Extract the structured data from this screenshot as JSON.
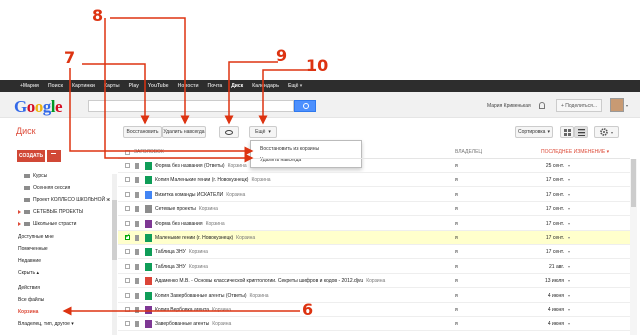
{
  "topbar": {
    "items": [
      "+Мария",
      "Поиск",
      "Картинки",
      "Карты",
      "Play",
      "YouTube",
      "Новости",
      "Почта",
      "Диск",
      "Календарь",
      "Ещё ▾"
    ],
    "active": "Диск"
  },
  "header": {
    "logo_letters": [
      "G",
      "o",
      "o",
      "g",
      "l",
      "e"
    ],
    "user_name": "Мария Кривенькая",
    "share_label": "+ Поделиться...",
    "avatar_caret": "▾"
  },
  "toolbar": {
    "app_title": "Диск",
    "restore_label": "Восстановить",
    "delete_label": "Удалить навсегда",
    "more_label": "Ещё",
    "more_caret": "▾",
    "sort_label": "Сортировка",
    "sort_caret": "▾",
    "gear_caret": "▾"
  },
  "dropdown": {
    "items": [
      "Восстановить из корзины",
      "Удалить навсегда"
    ]
  },
  "sidebar": {
    "create_label": "СОЗДАТЬ",
    "items": [
      {
        "label": "Курсы",
        "type": "folder"
      },
      {
        "label": "Осенняя сессия",
        "type": "folder"
      },
      {
        "label": "Проект КОЛЛЕСО ШКОЛЬНОЙ ж",
        "type": "folder"
      },
      {
        "label": "СЕТЕВЫЕ ПРОЕКТЫ",
        "type": "tree"
      },
      {
        "label": "Школьные страсти",
        "type": "tree"
      },
      {
        "label": "Доступные мне",
        "type": "nav"
      },
      {
        "label": "Помеченные",
        "type": "nav"
      },
      {
        "label": "Недавние",
        "type": "nav"
      },
      {
        "label": "Скрыть ▴",
        "type": "nav"
      },
      {
        "label": "Действия",
        "type": "nav"
      },
      {
        "label": "Все файлы",
        "type": "nav"
      },
      {
        "label": "Корзина",
        "type": "trash"
      },
      {
        "label": "Владелец, тип, другое ▾",
        "type": "nav"
      }
    ]
  },
  "list": {
    "col_title": "ЗАГОЛОВОК",
    "col_owner": "ВЛАДЕЛЕЦ",
    "col_modified": "ПОСЛЕДНЕЕ ИЗМЕНЕНИЕ",
    "col_modified_caret": "▾",
    "trash_tag": "Корзина",
    "row_caret": "▾",
    "rows": [
      {
        "name": "Форма без названия (Ответы)",
        "owner": "я",
        "date": "25 сент.",
        "icon": "sheet",
        "selected": false
      },
      {
        "name": "Копия Маленькие гении (г. Новокузнецк)",
        "owner": "я",
        "date": "17 сент.",
        "icon": "sheet",
        "selected": false
      },
      {
        "name": "Визитка команды ИСКАТЕЛИ",
        "owner": "я",
        "date": "17 сент.",
        "icon": "doc",
        "selected": false
      },
      {
        "name": "Сетевые проекты",
        "owner": "я",
        "date": "17 сент.",
        "icon": "folder",
        "selected": false
      },
      {
        "name": "Форма без названия",
        "owner": "я",
        "date": "17 сент.",
        "icon": "form",
        "selected": false
      },
      {
        "name": "Маленькие гении (г. Новокузнецк)",
        "owner": "я",
        "date": "17 сент.",
        "icon": "sheet",
        "selected": true
      },
      {
        "name": "Таблица ЗНУ",
        "owner": "я",
        "date": "17 сент.",
        "icon": "sheet",
        "selected": false
      },
      {
        "name": "Таблица ЗНУ",
        "owner": "я",
        "date": "21 авг.",
        "icon": "sheet",
        "selected": false
      },
      {
        "name": "Адаменко М.В. - Основы классической криптологии. Секреты шифров и кодов - 2012.djvu",
        "owner": "я",
        "date": "13 июля",
        "icon": "pdf",
        "selected": false
      },
      {
        "name": "Копия Завербованные агенты (Ответы)",
        "owner": "я",
        "date": "4 июня",
        "icon": "sheet",
        "selected": false
      },
      {
        "name": "Копия Вербовка агента",
        "owner": "я",
        "date": "4 июня",
        "icon": "form",
        "selected": false
      },
      {
        "name": "Завербованные агенты",
        "owner": "я",
        "date": "4 июня",
        "icon": "form",
        "selected": false
      },
      {
        "name": "Буклет для родителей.pdf",
        "owner": "я",
        "date": "4 июня",
        "icon": "pdf",
        "selected": false
      }
    ]
  },
  "annotations": [
    "6",
    "7",
    "8",
    "9",
    "10"
  ],
  "colors": {
    "accent_red": "#dd4b39",
    "annotation_red": "#dd3311",
    "selected_row": "#ffffcc",
    "blue_button": "#4d90fe"
  }
}
